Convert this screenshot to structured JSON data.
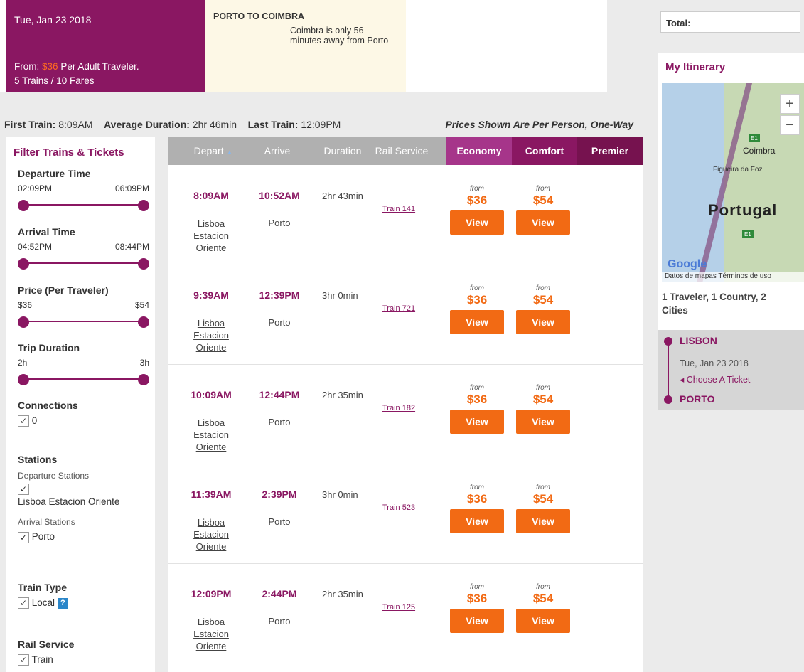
{
  "hero": {
    "date": "Tue, Jan 23 2018",
    "from_prefix": "From:",
    "from_price": "$36",
    "from_suffix": "Per Adult Traveler.",
    "trains_fares": "5 Trains /   10 Fares",
    "route_title": "PORTO TO COIMBRA",
    "route_text": "Coimbra is only 56 minutes away from Porto"
  },
  "summary": {
    "first_label": "First Train:",
    "first_value": "8:09AM",
    "avg_label": "Average Duration:",
    "avg_value": "2hr 46min",
    "last_label": "Last Train:",
    "last_value": "12:09PM",
    "note": "Prices Shown Are Per Person, One-Way"
  },
  "filters": {
    "title": "Filter Trains & Tickets",
    "departure": {
      "title": "Departure Time",
      "min": "02:09PM",
      "max": "06:09PM"
    },
    "arrival": {
      "title": "Arrival Time",
      "min": "04:52PM",
      "max": "08:44PM"
    },
    "price": {
      "title": "Price (Per Traveler)",
      "min": "$36",
      "max": "$54"
    },
    "duration": {
      "title": "Trip Duration",
      "min": "2h",
      "max": "3h"
    },
    "connections": {
      "title": "Connections",
      "option": "0"
    },
    "stations": {
      "title": "Stations",
      "dep_label": "Departure Stations",
      "dep_option": "Lisboa Estacion Oriente",
      "arr_label": "Arrival Stations",
      "arr_option": "Porto"
    },
    "train_type": {
      "title": "Train Type",
      "option": "Local",
      "help": "?"
    },
    "rail_service": {
      "title": "Rail Service",
      "option": "Train"
    },
    "check_glyph": "✓"
  },
  "table": {
    "headers": {
      "depart": "Depart",
      "arrive": "Arrive",
      "duration": "Duration",
      "rail_service": "Rail Service",
      "economy": "Economy",
      "comfort": "Comfort",
      "premier": "Premier"
    },
    "from_label": "from",
    "view_label": "View",
    "rows": [
      {
        "depart": "8:09AM",
        "dep_station": "Lisboa Estacion Oriente",
        "arrive": "10:52AM",
        "arr_station": "Porto",
        "duration": "2hr 43min",
        "service": "Train 141",
        "economy": "$36",
        "comfort": "$54"
      },
      {
        "depart": "9:39AM",
        "dep_station": "Lisboa Estacion Oriente",
        "arrive": "12:39PM",
        "arr_station": "Porto",
        "duration": "3hr 0min",
        "service": "Train 721",
        "economy": "$36",
        "comfort": "$54"
      },
      {
        "depart": "10:09AM",
        "dep_station": "Lisboa Estacion Oriente",
        "arrive": "12:44PM",
        "arr_station": "Porto",
        "duration": "2hr 35min",
        "service": "Train 182",
        "economy": "$36",
        "comfort": "$54"
      },
      {
        "depart": "11:39AM",
        "dep_station": "Lisboa Estacion Oriente",
        "arrive": "2:39PM",
        "arr_station": "Porto",
        "duration": "3hr 0min",
        "service": "Train 523",
        "economy": "$36",
        "comfort": "$54"
      },
      {
        "depart": "12:09PM",
        "dep_station": "Lisboa Estacion Oriente",
        "arrive": "2:44PM",
        "arr_station": "Porto",
        "duration": "2hr 35min",
        "service": "Train 125",
        "economy": "$36",
        "comfort": "$54"
      }
    ]
  },
  "sidebar": {
    "total_label": "Total:",
    "itinerary_title": "My Itinerary",
    "map": {
      "country": "Portugal",
      "city_coimbra": "Coimbra",
      "city_figueira": "Figueira da Foz",
      "road_label": "E1",
      "google": "Google",
      "attribution": "Datos de mapas   Términos de uso",
      "zoom_in": "+",
      "zoom_out": "−"
    },
    "traveler_summary": "1 Traveler, 1 Country, 2 Cities",
    "stop1_city": "LISBON",
    "stop1_date": "Tue, Jan 23 2018",
    "choose_ticket": "◂  Choose A Ticket",
    "stop2_city": "PORTO"
  },
  "colors": {
    "brand": "#8a1762",
    "accent": "#f26a14",
    "economy": "#a6358a",
    "premier": "#76124f"
  }
}
